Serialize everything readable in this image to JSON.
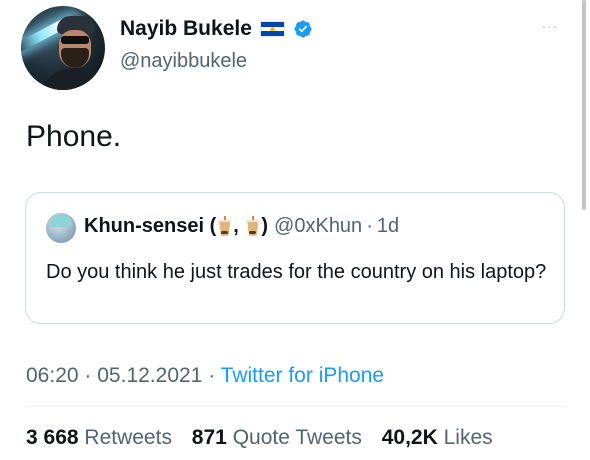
{
  "author": {
    "display_name": "Nayib Bukele",
    "handle": "@nayibbukele",
    "flag_icon": "el-salvador-flag-icon",
    "verified_icon": "verified-badge-icon",
    "verified_color": "#1d9bf0"
  },
  "more_icon": "more-options-icon",
  "more_label": "···",
  "tweet": {
    "text": "Phone."
  },
  "quote": {
    "name_prefix": "Khun-sensei (",
    "name_sep": ",",
    "name_suffix": ")",
    "name_emoji": "bubble-tea-icon",
    "handle": "@0xKhun",
    "sep": "·",
    "time": "1d",
    "text": "Do you think he just trades for the country on his laptop?"
  },
  "meta": {
    "time": "06:20",
    "sep1": "·",
    "date": "05.12.2021",
    "sep2": "·",
    "source": "Twitter for iPhone"
  },
  "stats": [
    {
      "count": "3 668",
      "label": "Retweets"
    },
    {
      "count": "871",
      "label": "Quote Tweets"
    },
    {
      "count": "40,2K",
      "label": "Likes"
    }
  ],
  "colors": {
    "text": "#0f1419",
    "secondary": "#536471",
    "link": "#1d9bf0",
    "border": "#cfd9de"
  }
}
